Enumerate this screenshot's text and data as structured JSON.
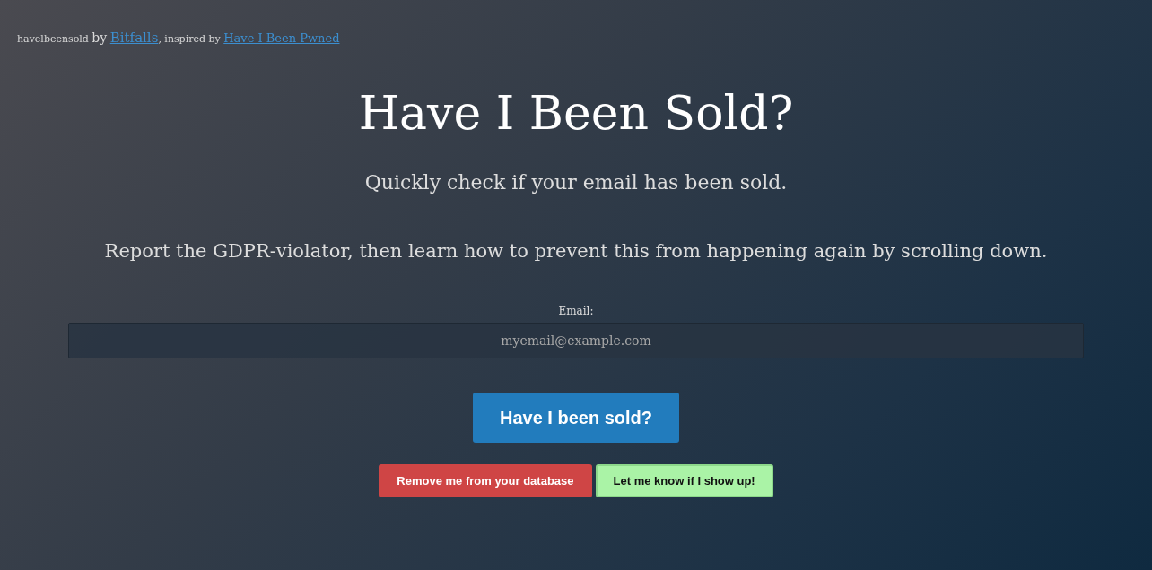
{
  "credits": [
    {
      "kind": "small",
      "text": "havelbeensold"
    },
    {
      "kind": "large",
      "text": "by"
    },
    {
      "kind": "link",
      "text": "Bitfalls"
    },
    {
      "kind": "small",
      "text": ", inspired by"
    },
    {
      "kind": "link",
      "text": "Have I Been Pwned"
    }
  ],
  "title": "Have I Been Sold?",
  "subtitle": "Quickly check if your email has been sold.",
  "instructions": "Report the GDPR-violator, then learn how to prevent this from happening again by scrolling down.",
  "email_field": {
    "label": "Email:",
    "placeholder": "myemail@example.com"
  },
  "buttons": [
    {
      "kind": "primary",
      "label": "Have I been sold?"
    },
    {
      "kind": "danger",
      "label": "Remove me from your database"
    },
    {
      "kind": "success",
      "label": "Let me know if I show up!"
    }
  ]
}
